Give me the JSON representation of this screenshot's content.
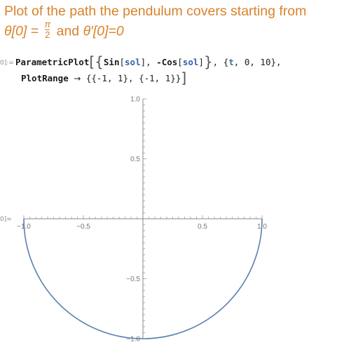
{
  "heading": {
    "line1": "Plot of the path the pendulum covers starting from",
    "theta0_lhs": "θ[0] = ",
    "frac_num": "π",
    "frac_den": "2",
    "and": " and ",
    "theta0p": "θ′[0]=0"
  },
  "cell": {
    "in_label": "0]:=",
    "out_label": "0]=",
    "line1": {
      "fn": "ParametricPlot",
      "open_outer": "[",
      "open_list": "{",
      "sin": "Sin",
      "open1": "[",
      "sol1": "sol",
      "close1": "]",
      "comma1": ", ",
      "neg": "-",
      "cos": "Cos",
      "open2": "[",
      "sol2": "sol",
      "close2": "]",
      "close_list": "}",
      "comma2": ", ",
      "range_open": "{",
      "t": "t",
      "range_rest": ", 0, 10}",
      "trailing": ","
    },
    "line2": {
      "opt": "PlotRange",
      "arrow": "→",
      "value": " {{-1, 1}, {-1, 1}}",
      "close_outer": "]"
    }
  },
  "chart_data": {
    "type": "line",
    "title": "",
    "xlabel": "",
    "ylabel": "",
    "xlim": [
      -1,
      1
    ],
    "ylim": [
      -1,
      1
    ],
    "x_ticks": [
      -1.0,
      -0.5,
      0.5,
      1.0
    ],
    "y_ticks": [
      -1.0,
      -0.5,
      0.5,
      1.0
    ],
    "x_tick_labels": [
      "-1.0",
      "-0.5",
      "0.5",
      "1.0"
    ],
    "y_tick_labels": [
      "-1.0",
      "-0.5",
      "0.5",
      "1.0"
    ],
    "grid": false,
    "series": [
      {
        "color": "#5b7fb0",
        "x": [
          -1.0,
          -0.966,
          -0.866,
          -0.707,
          -0.5,
          -0.259,
          0.0,
          0.259,
          0.5,
          0.707,
          0.866,
          0.966,
          1.0
        ],
        "y": [
          0.0,
          -0.259,
          -0.5,
          -0.707,
          -0.866,
          -0.966,
          -1.0,
          -0.966,
          -0.866,
          -0.707,
          -0.5,
          -0.259,
          0.0
        ]
      }
    ]
  }
}
